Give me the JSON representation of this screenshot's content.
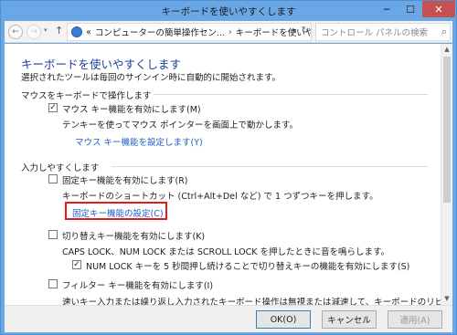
{
  "window": {
    "title": "キーボードを使いやすくします",
    "min_glyph": "─",
    "max_glyph": "☐",
    "close_glyph": "✕"
  },
  "nav": {
    "back_glyph": "←",
    "forward_glyph": "→",
    "history_glyph": "▾",
    "up_glyph": "↑",
    "breadcrumb_prefix": "«",
    "breadcrumb_1": "コンピューターの簡単操作セン...",
    "breadcrumb_sep": "›",
    "breadcrumb_2": "キーボードを使いやすくします",
    "dropdown_glyph": "▾",
    "refresh_glyph": "↻",
    "search_placeholder": "コントロール パネルの検索",
    "search_glyph": "⌕"
  },
  "main": {
    "title": "キーボードを使いやすくします",
    "subtitle": "選択されたツールは毎回のサインイン時に自動的に開始されます。",
    "sections": {
      "mouse_keyboard": {
        "heading": "マウスをキーボードで操作します",
        "mouse_keys_checkbox": "マウス キー機能を有効にします(M)",
        "mouse_keys_checked": true,
        "mouse_keys_desc": "テンキーを使ってマウス ポインターを画面上で動かします。",
        "mouse_keys_link": "マウス キー機能を設定します(Y)"
      },
      "typing": {
        "heading": "入力しやすくします",
        "sticky_checkbox": "固定キー機能を有効にします(R)",
        "sticky_checked": false,
        "sticky_desc": "キーボードのショートカット (Ctrl+Alt+Del など) で 1 つずつキーを押します。",
        "sticky_link": "固定キー機能の設定(C)",
        "toggle_checkbox": "切り替えキー機能を有効にします(K)",
        "toggle_checked": false,
        "toggle_desc": "CAPS LOCK、NUM LOCK または SCROLL LOCK を押したときに音を鳴らします。",
        "numlock_checkbox": "NUM LOCK キーを 5 秒間押し続けることで切り替えキーの機能を有効にします(S)",
        "numlock_checked": true,
        "filter_checkbox": "フィルター キー機能を有効にします(I)",
        "filter_checked": false,
        "filter_desc": "速いキー入力または繰り返し入力されたキーボード操作は無視または減速して、キーボードのリピート間隔を調節します。"
      }
    },
    "check_glyph": "✓"
  },
  "footer": {
    "ok_label": "OK(O)",
    "cancel_label": "キャンセル",
    "apply_label": "適用(A)"
  },
  "scrollbar": {
    "up_glyph": "▲",
    "down_glyph": "▼"
  },
  "colors": {
    "title_bar": "#6aa7e6",
    "link": "#1e5ec8",
    "heading": "#1f3f9a",
    "highlight": "#e41b1b",
    "close_button": "#c75050"
  }
}
